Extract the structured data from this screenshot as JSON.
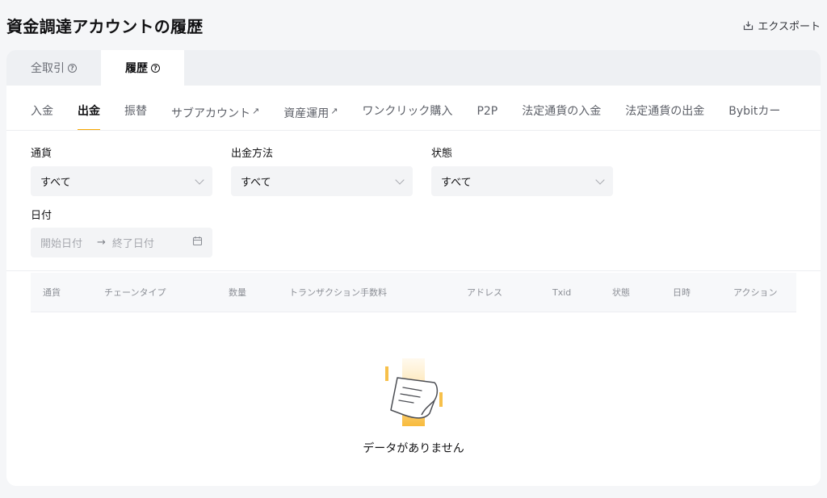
{
  "header": {
    "title": "資金調達アカウントの履歴",
    "export_label": "エクスポート"
  },
  "top_tabs": [
    {
      "label": "全取引"
    },
    {
      "label": "履歴"
    }
  ],
  "sub_tabs": [
    {
      "label": "入金"
    },
    {
      "label": "出金"
    },
    {
      "label": "振替"
    },
    {
      "label": "サブアカウント"
    },
    {
      "label": "資産運用"
    },
    {
      "label": "ワンクリック購入"
    },
    {
      "label": "P2P"
    },
    {
      "label": "法定通貨の入金"
    },
    {
      "label": "法定通貨の出金"
    },
    {
      "label": "Bybitカー"
    }
  ],
  "filters": {
    "currency": {
      "label": "通貨",
      "value": "すべて"
    },
    "method": {
      "label": "出金方法",
      "value": "すべて"
    },
    "status": {
      "label": "状態",
      "value": "すべて"
    },
    "date": {
      "label": "日付",
      "start_placeholder": "開始日付",
      "end_placeholder": "終了日付"
    }
  },
  "table": {
    "columns": [
      "通貨",
      "チェーンタイプ",
      "数量",
      "トランザクション手数料",
      "アドレス",
      "Txid",
      "状態",
      "日時",
      "アクション"
    ]
  },
  "empty_state": {
    "text": "データがありません"
  },
  "colors": {
    "accent": "#f7a600",
    "background": "#f5f6f8",
    "card": "#ffffff"
  }
}
